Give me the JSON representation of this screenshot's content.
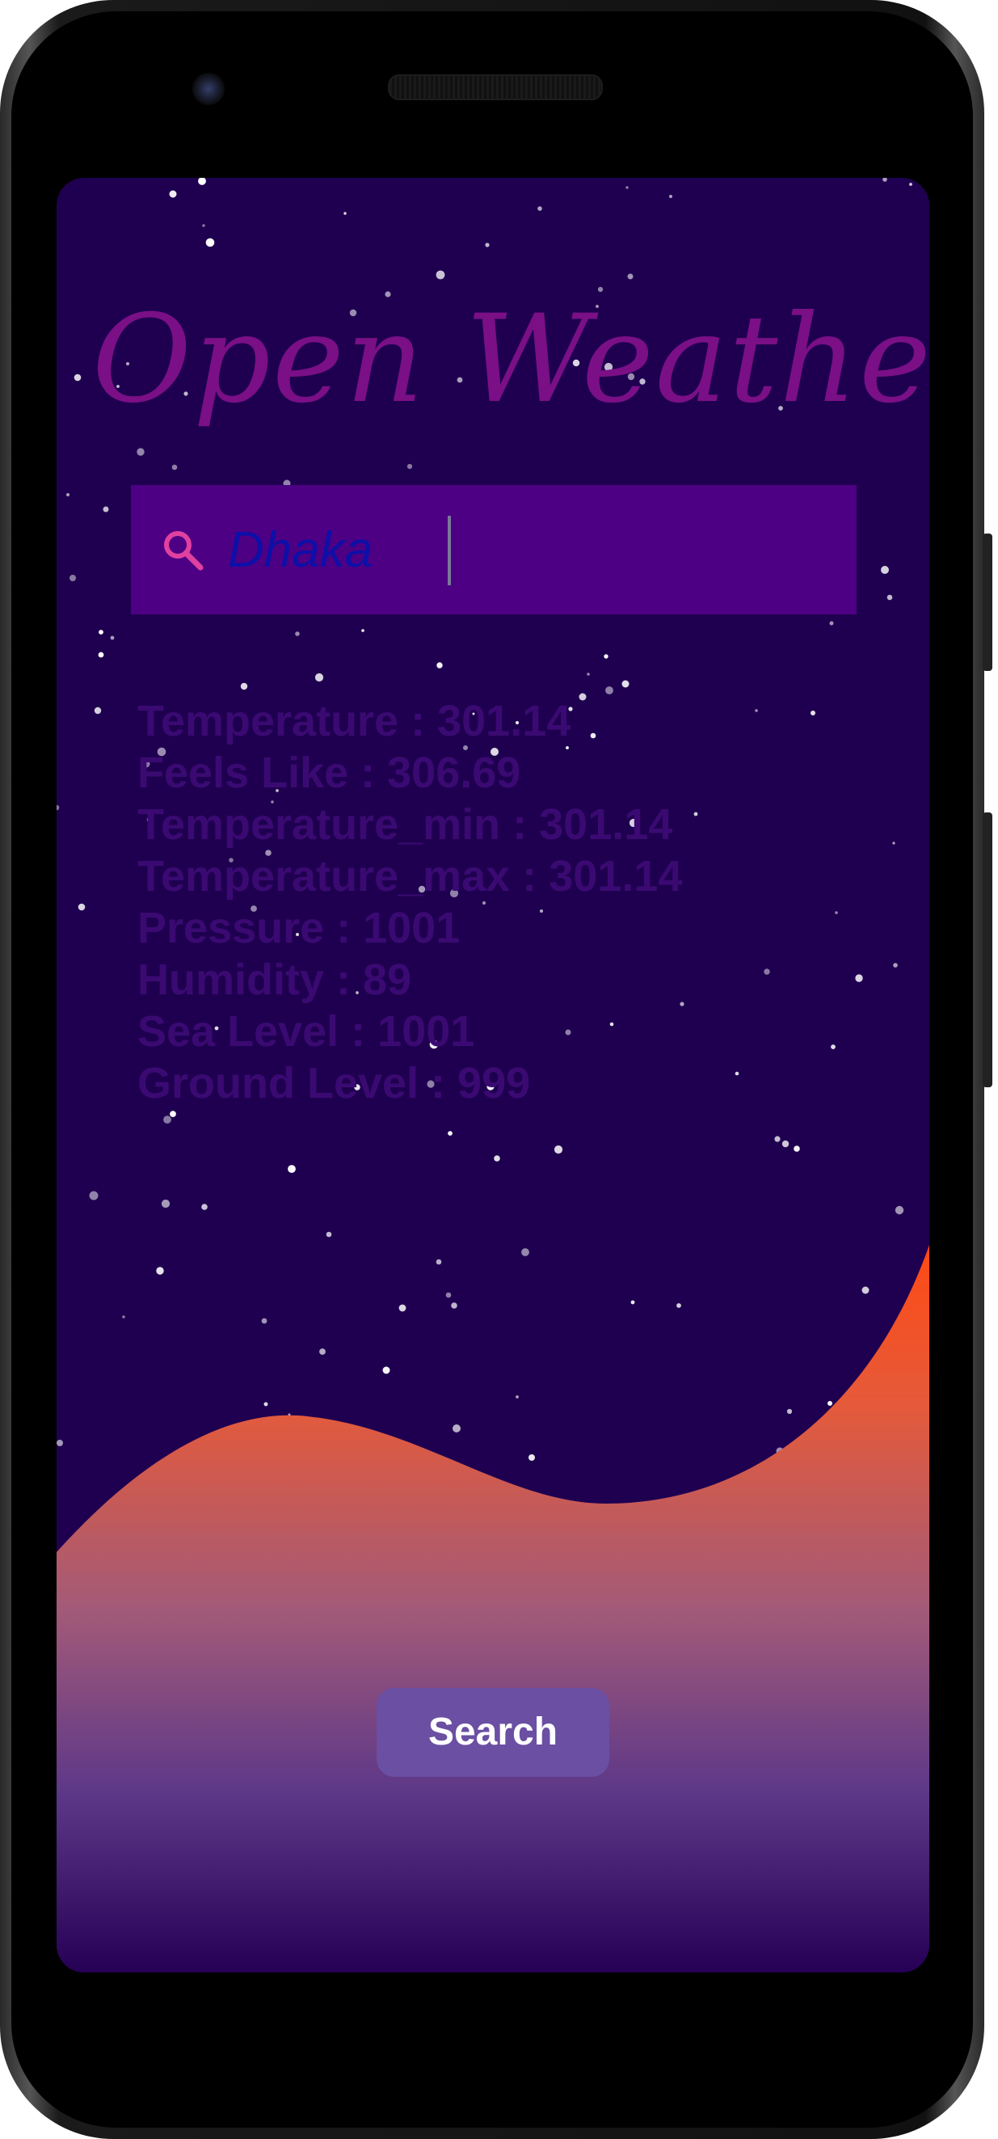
{
  "app": {
    "title": "Open Weather"
  },
  "search": {
    "value": "Dhaka",
    "icon": "search-icon",
    "icon_color": "#e040a0"
  },
  "weather": {
    "lines": [
      "Temperature : 301.14",
      "Feels Like : 306.69",
      "Temperature_min : 301.14",
      "Temperature_max : 301.14",
      "Pressure : 1001",
      "Humidity : 89",
      "Sea Level : 1001",
      "Ground Level : 999"
    ]
  },
  "actions": {
    "search_label": "Search"
  },
  "colors": {
    "background": "#1f0050",
    "title": "#7a0f86",
    "search_box": "#4d0083",
    "input_text": "#0d0fa8",
    "wave_top": "#ff4a14",
    "wave_bottom": "#260055",
    "button": "#6a4fa3"
  }
}
